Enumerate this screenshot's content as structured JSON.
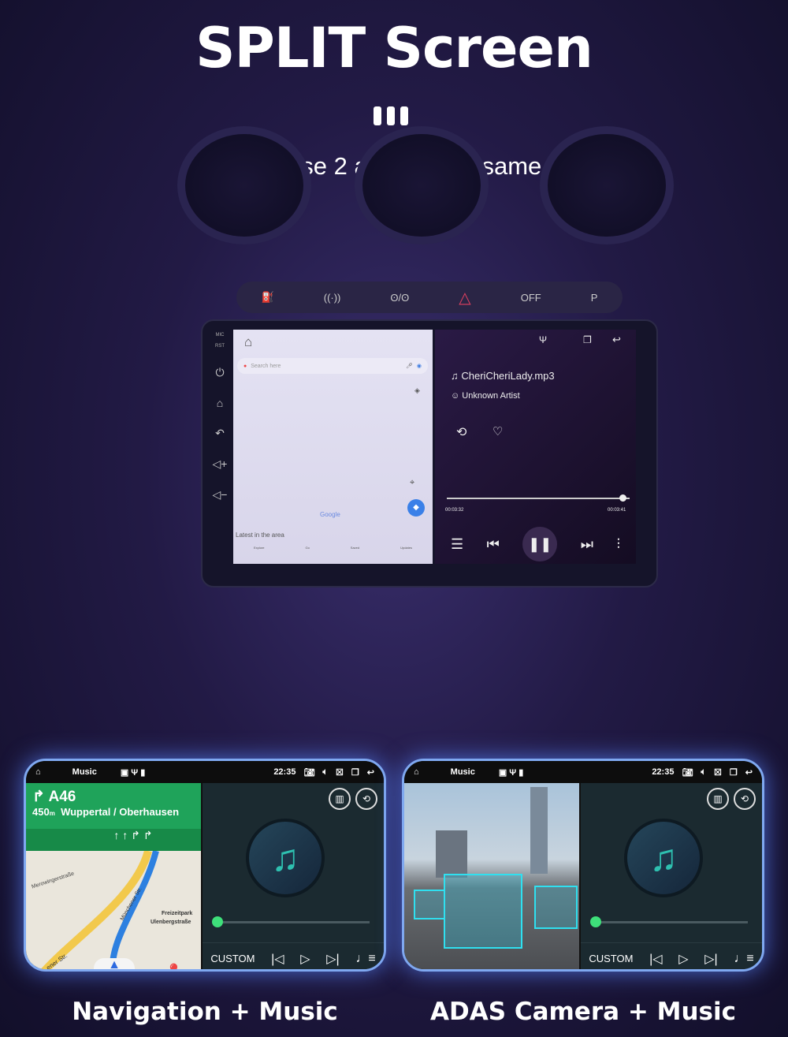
{
  "hero": {
    "title": "SPLIT Screen",
    "subtitle": "You can use 2 apps at the same time"
  },
  "dash_buttons": [
    "⛽",
    "((·))",
    "ʘ/ʘ",
    "△",
    "OFF",
    "P"
  ],
  "head_unit": {
    "side_labels": {
      "mic": "MIC",
      "rst": "RST"
    },
    "side_icons": [
      "power-icon",
      "home-icon",
      "back-icon",
      "volume-up-icon",
      "volume-down-icon"
    ],
    "map": {
      "search_placeholder": "Search here",
      "brand": "Google",
      "sheet_title": "Latest in the area",
      "tabs": [
        "Explore",
        "Go",
        "Saved",
        "Updates"
      ]
    },
    "music": {
      "track": "CheriCheriLady.mp3",
      "artist": "Unknown Artist",
      "elapsed": "00:03:32",
      "total": "00:03:41",
      "progress": 0.96
    }
  },
  "cards": [
    {
      "caption": "Navigation + Music",
      "status_app": "Music",
      "time": "22:35",
      "nav": {
        "road": "A46",
        "distance": "450",
        "unit": "m",
        "direction": "Wuppertal / Oberhausen",
        "streets": [
          "Merowingerstraße",
          "Münchener Str.",
          "Freizeitpark",
          "Ulenbergstraße",
          "ener Str."
        ]
      },
      "player": {
        "mode": "CUSTOM",
        "progress": 0
      }
    },
    {
      "caption": "ADAS Camera + Music",
      "status_app": "Music",
      "time": "22:35",
      "player": {
        "mode": "CUSTOM",
        "progress": 0
      }
    }
  ]
}
